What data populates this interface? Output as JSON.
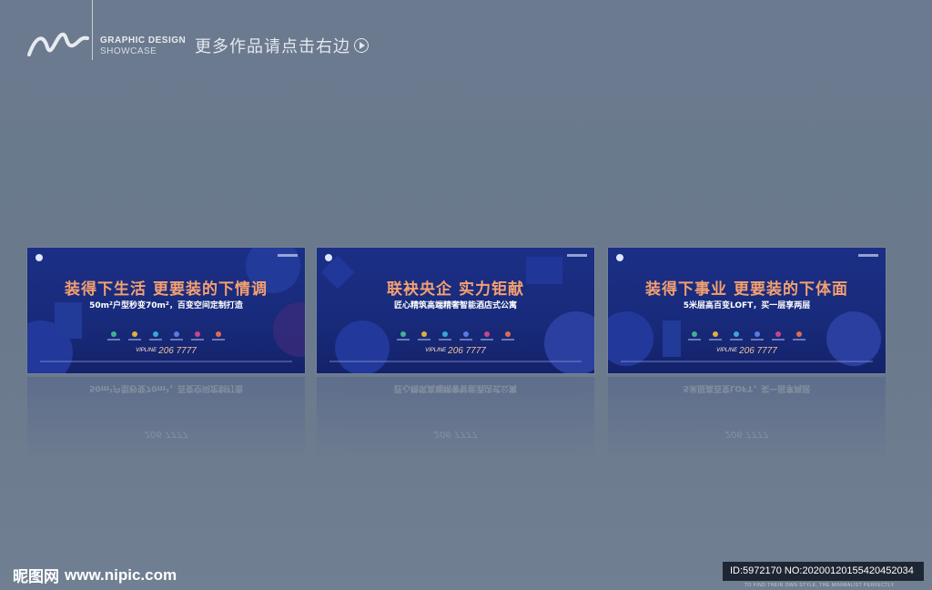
{
  "header": {
    "brand_line1": "GRAPHIC DESIGN",
    "brand_line2": "SHOWCASE",
    "more_text": "更多作品请点击右边"
  },
  "boards": [
    {
      "headline": "装得下生活  更要装的下情调",
      "subline": "50m²户型秒变70m²，百变空间定制打造",
      "phone_prefix": "VIPLINE",
      "phone": "206 7777",
      "mirror_sub": "50m²户型秒变70m²，百变空间定制打造"
    },
    {
      "headline": "联袂央企    实力钜献",
      "subline": "匠心精筑高端精奢智能酒店式公寓",
      "phone_prefix": "VIPLINE",
      "phone": "206 7777",
      "mirror_sub": "匠心精筑高端精奢智能酒店式公寓"
    },
    {
      "headline": "装得下事业  更要装的下体面",
      "subline": "5米层高百变LOFT，买一层享两层",
      "phone_prefix": "VIPLINE",
      "phone": "206 7777",
      "mirror_sub": "5米层高百变LOFT，买一层享两居"
    }
  ],
  "footer": {
    "watermark_cn": "昵图网",
    "watermark_url": "www.nipic.com",
    "id_text": "ID:5972170 NO:20200120155420452034",
    "tagline": "TO FIND THEIR OWN STYLE, THE MINIMALIST PERFECTLY"
  },
  "colors": {
    "background": "#6b7a8e",
    "board_blue": "#1b2f86",
    "headline_orange": "#f4a070",
    "dot_colors": [
      "#3fb38f",
      "#e0b13a",
      "#3aa7d8",
      "#5a7be0",
      "#c2468d",
      "#e46a4d"
    ]
  }
}
